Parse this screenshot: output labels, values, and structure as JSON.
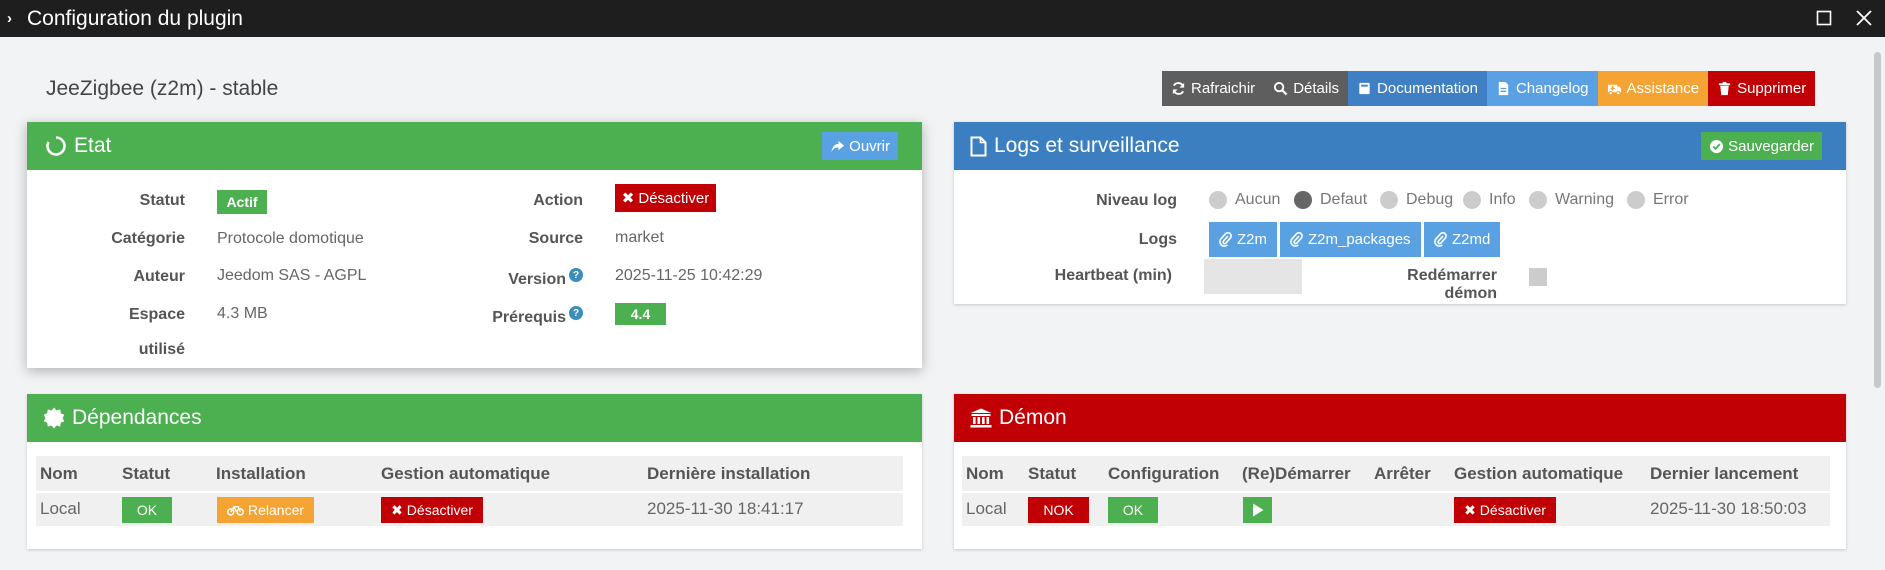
{
  "window": {
    "title": "Configuration du plugin"
  },
  "page_title": "JeeZigbee (z2m) - stable",
  "toolbar": {
    "refresh": "Rafraichir",
    "details": "Détails",
    "documentation": "Documentation",
    "changelog": "Changelog",
    "assistance": "Assistance",
    "delete": "Supprimer"
  },
  "etat": {
    "title": "Etat",
    "open_button": "Ouvrir",
    "labels": {
      "statut": "Statut",
      "categorie": "Catégorie",
      "auteur": "Auteur",
      "espace": "Espace",
      "espace2": "utilisé",
      "action": "Action",
      "source": "Source",
      "version": "Version",
      "prerequis": "Prérequis"
    },
    "values": {
      "statut": "Actif",
      "categorie": "Protocole domotique",
      "auteur": "Jeedom SAS - AGPL",
      "espace": "4.3 MB",
      "action": "Désactiver",
      "source": "market",
      "version": "2025-11-25 10:42:29",
      "prerequis": "4.4"
    },
    "help_glyph": "?"
  },
  "logs": {
    "title": "Logs et surveillance",
    "save_button": "Sauvegarder",
    "niveau_label": "Niveau log",
    "levels": [
      {
        "label": "Aucun",
        "selected": false
      },
      {
        "label": "Defaut",
        "selected": true
      },
      {
        "label": "Debug",
        "selected": false
      },
      {
        "label": "Info",
        "selected": false
      },
      {
        "label": "Warning",
        "selected": false
      },
      {
        "label": "Error",
        "selected": false
      }
    ],
    "logs_label": "Logs",
    "log_buttons": [
      "Z2m",
      "Z2m_packages",
      "Z2md"
    ],
    "heartbeat_label": "Heartbeat (min)",
    "heartbeat_value": "",
    "restart_label": "Redémarrer démon"
  },
  "dependances": {
    "title": "Dépendances",
    "headers": [
      "Nom",
      "Statut",
      "Installation",
      "Gestion automatique",
      "Dernière installation"
    ],
    "row": {
      "nom": "Local",
      "statut": "OK",
      "installation": "Relancer",
      "gestion": "Désactiver",
      "derniere": "2025-11-30 18:41:17"
    }
  },
  "demon": {
    "title": "Démon",
    "headers": [
      "Nom",
      "Statut",
      "Configuration",
      "(Re)Démarrer",
      "Arrêter",
      "Gestion automatique",
      "Dernier lancement"
    ],
    "row": {
      "nom": "Local",
      "statut": "NOK",
      "configuration": "OK",
      "gestion": "Désactiver",
      "dernier": "2025-11-30 18:50:03"
    }
  },
  "colors": {
    "green": "#4caf50",
    "blue": "#3c7fc0",
    "red": "#c10005",
    "orange": "#f5a332",
    "gray_dark": "#5e5e5e",
    "light_blue": "#5aa1e3",
    "doc_blue": "#3f7fc3"
  }
}
